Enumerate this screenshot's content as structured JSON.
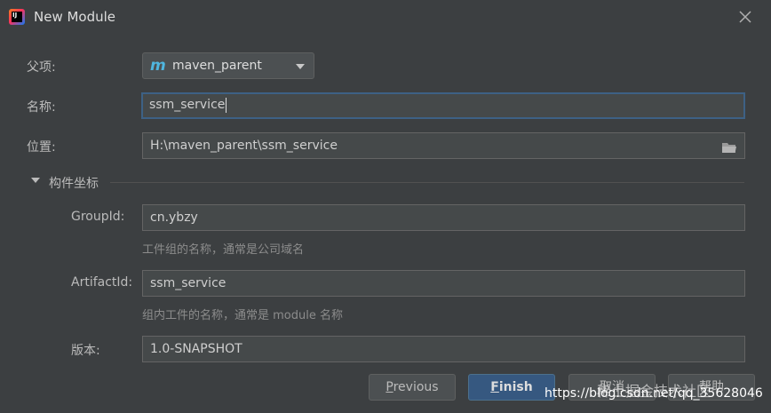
{
  "window": {
    "title": "New Module"
  },
  "form": {
    "parent_label": "父项:",
    "parent_value": "maven_parent",
    "name_label": "名称:",
    "name_value": "ssm_service",
    "location_label": "位置:",
    "location_value": "H:\\maven_parent\\ssm_service"
  },
  "artifact": {
    "section_title": "构件坐标",
    "group_label": "GroupId:",
    "group_value": "cn.ybzy",
    "group_hint": "工件组的名称，通常是公司域名",
    "artifact_label": "ArtifactId:",
    "artifact_value": "ssm_service",
    "artifact_hint": "组内工件的名称，通常是 module 名称",
    "version_label": "版本:",
    "version_value": "1.0-SNAPSHOT"
  },
  "buttons": {
    "previous_first": "P",
    "previous_rest": "revious",
    "finish_first": "F",
    "finish_rest": "inish",
    "cancel": "取消",
    "help": "帮助"
  },
  "watermark": {
    "site": "稀土掘金技术社区",
    "url": "https://blog.csdn.net/qq_35628046"
  },
  "colors": {
    "background": "#3c3f41",
    "field_bg": "#45494a",
    "focus_border": "#3d6185",
    "default_button": "#365880"
  }
}
